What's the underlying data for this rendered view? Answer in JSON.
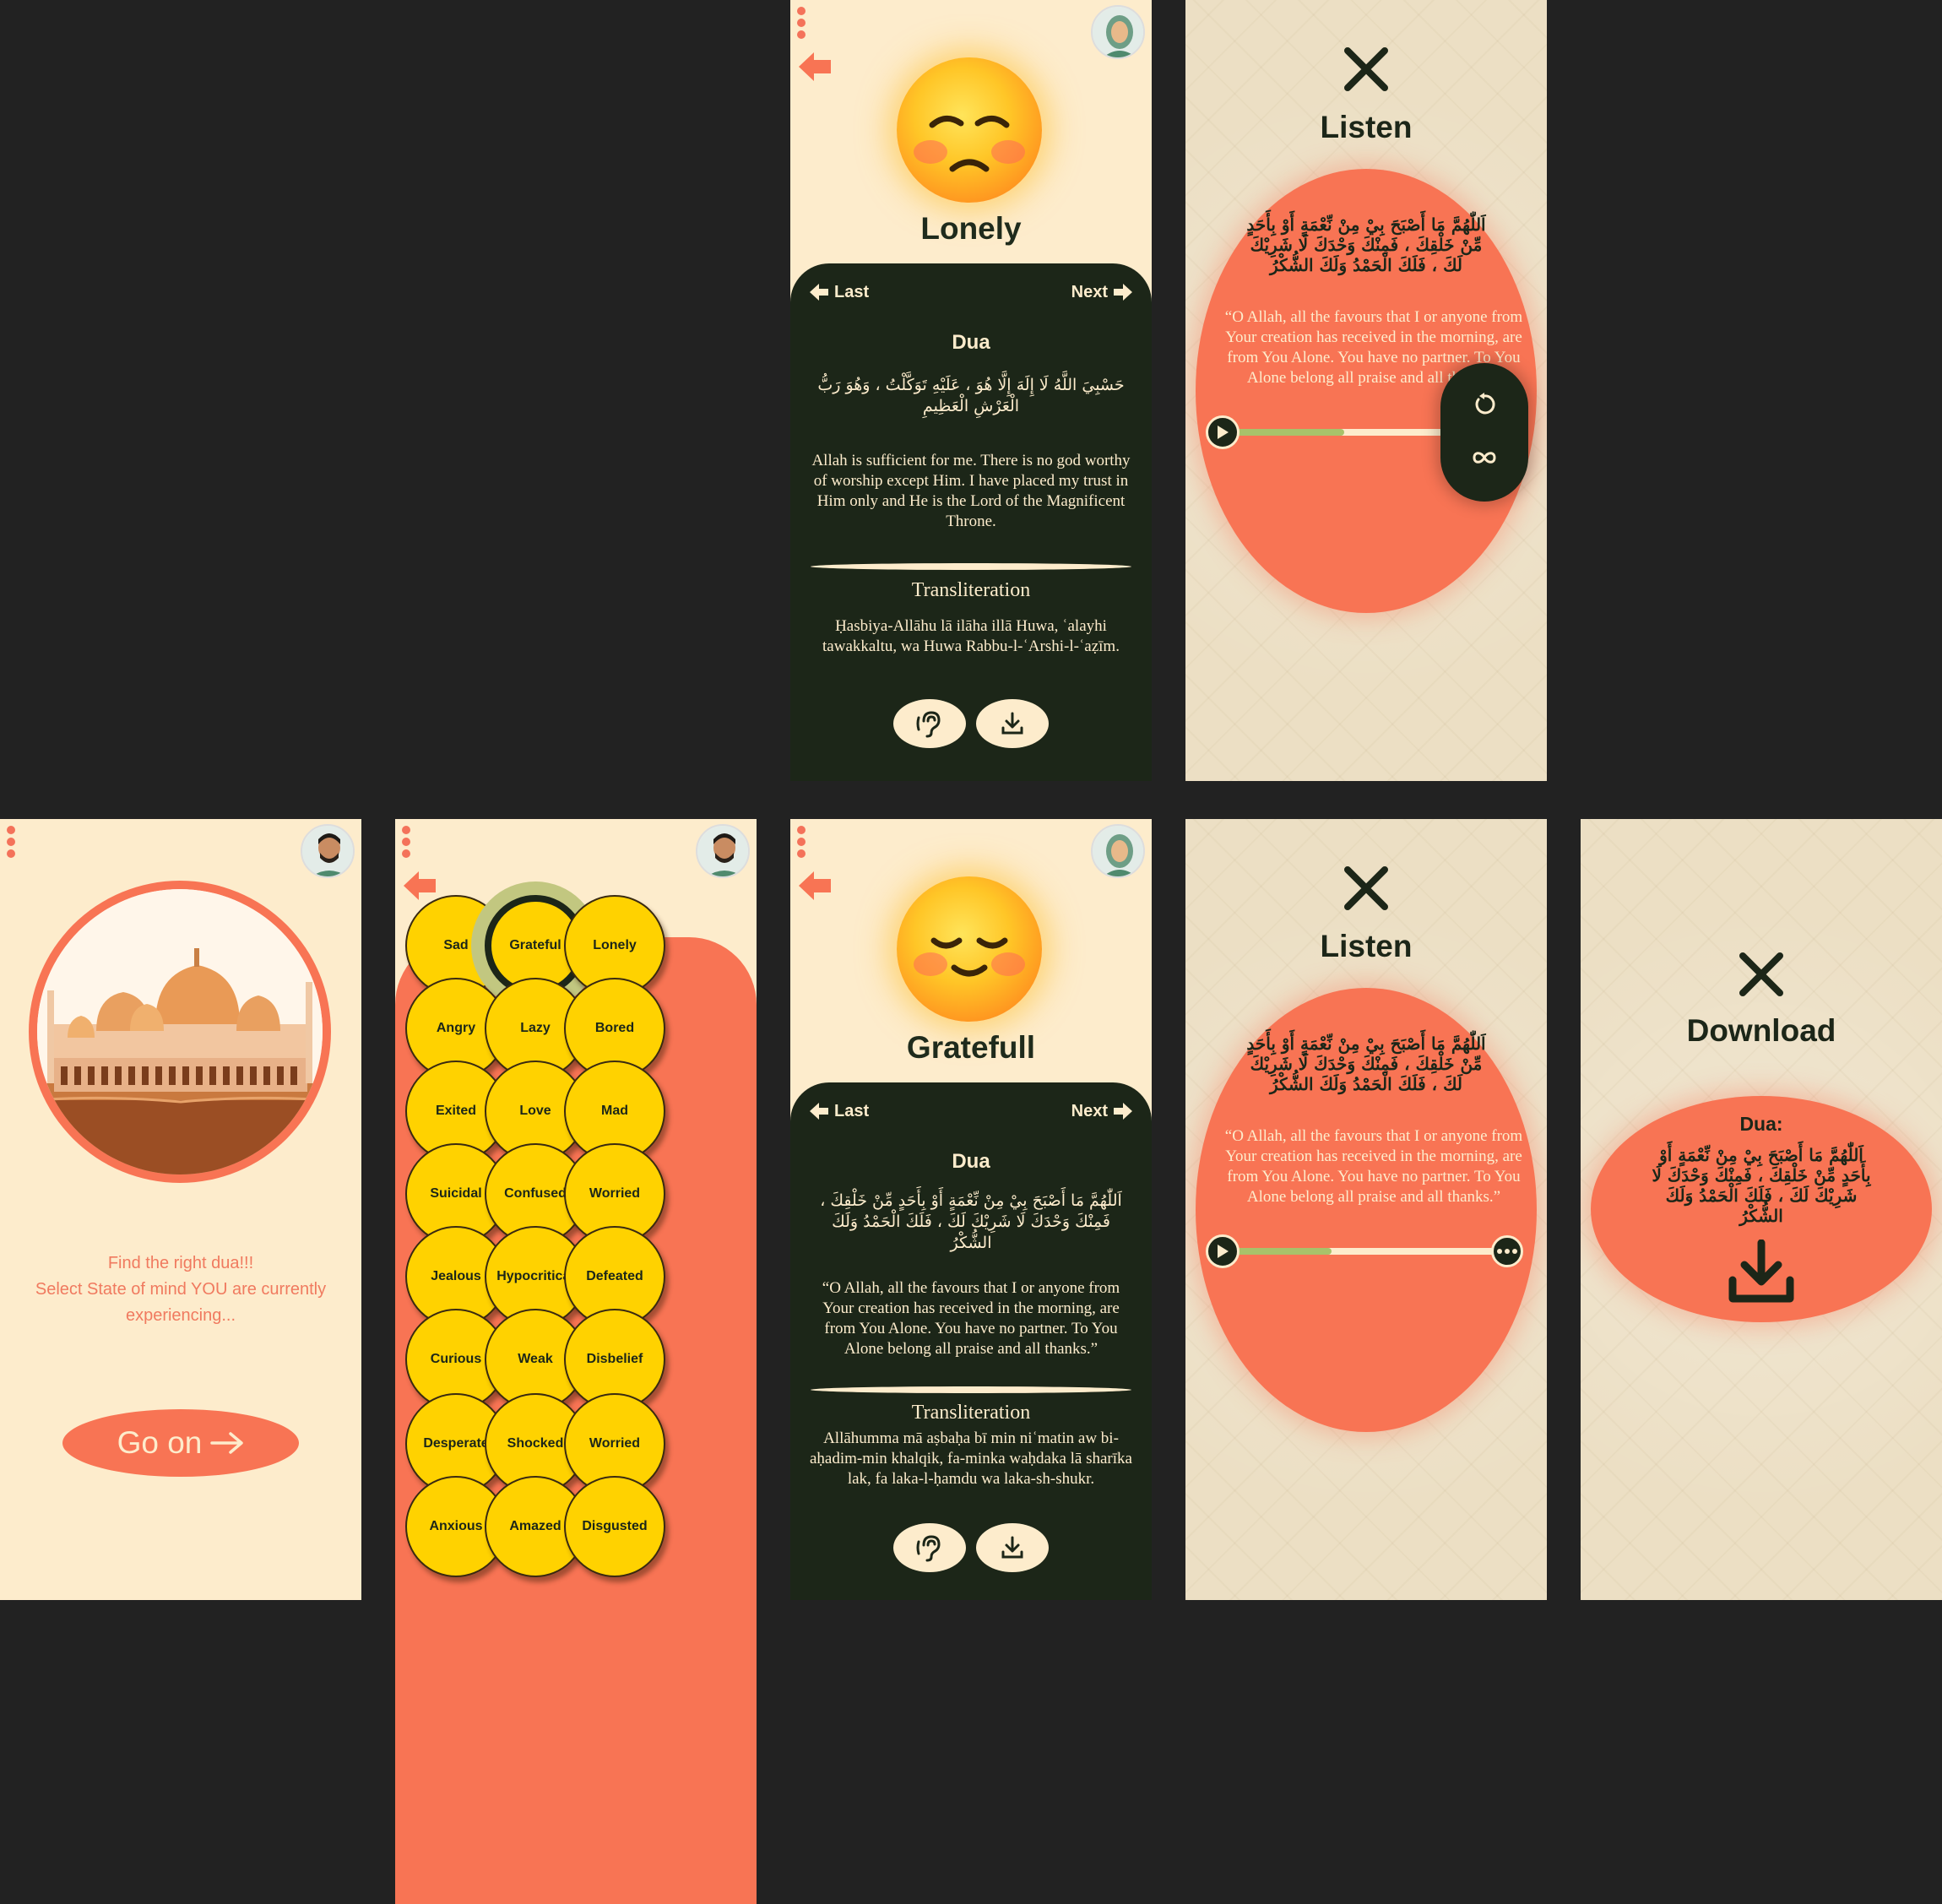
{
  "screens": {
    "lonely": {
      "mood_title": "Lonely",
      "last_label": "Last",
      "next_label": "Next",
      "dua_heading": "Dua",
      "arabic": "حَسْبِيَ اللَّهُ لَا إِلَهَ إِلَّا هُوَ ، عَلَيْهِ تَوَكَّلْتُ ، وَهُوَ رَبُّ الْعَرْشِ الْعَظِيمِ",
      "translation": "Allah is sufficient for me. There is no god worthy of worship except Him. I have placed my trust in Him only and He is the Lord of the Magnificent Throne.",
      "translit_heading": "Transliteration",
      "transliteration": "Ḥasbiya-Allāhu lā ilāha illā Huwa, ʿalayhi tawakkaltu, wa Huwa Rabbu-l-ʿArshi-l-ʿaẓīm."
    },
    "listen_menu": {
      "title": "Listen",
      "arabic": "اَللّٰهُمَّ مَا أَصْبَحَ بِيْ مِنْ نِّعْمَةٍ أَوْ بِأَحَدٍ مِّنْ خَلْقِكَ ، فَمِنْكَ وَحْدَكَ لَا شَرِيْكَ لَكَ ، فَلَكَ الْحَمْدُ وَلَكَ الشُّكْرُ",
      "translation": "“O Allah, all the favours that I or anyone from Your creation has received in the morning, are from You Alone. You have no partner. To You Alone belong all praise and all thanks.”",
      "progress": 0.48
    },
    "welcome": {
      "find_text_1": "Find the right dua!!!",
      "find_text_2": "Select State of mind YOU are currently experiencing...",
      "go_label": "Go on"
    },
    "moods": {
      "items": [
        "Sad",
        "Grateful",
        "Lonely",
        "Angry",
        "Lazy",
        "Bored",
        "Exited",
        "Love",
        "Mad",
        "Suicidal",
        "Confused",
        "Worried",
        "Jealous",
        "Hypocritical",
        "Defeated",
        "Curious",
        "Weak",
        "Disbelief",
        "Desperate",
        "Shocked",
        "Worried",
        "Anxious",
        "Amazed",
        "Disgusted"
      ],
      "selected": "Grateful"
    },
    "grateful": {
      "mood_title": "Gratefull",
      "last_label": "Last",
      "next_label": "Next",
      "dua_heading": "Dua",
      "arabic": "اَللّٰهُمَّ مَا أَصْبَحَ بِيْ مِنْ نِّعْمَةٍ أَوْ بِأَحَدٍ مِّنْ خَلْقِكَ ، فَمِنْكَ وَحْدَكَ لَا شَرِيْكَ لَكَ ، فَلَكَ الْحَمْدُ وَلَكَ الشُّكْرُ",
      "translation": "“O Allah, all the favours that I or anyone from Your creation has received in the morning, are from You Alone. You have no partner. To You Alone belong all praise and all thanks.”",
      "translit_heading": "Transliteration",
      "transliteration": "Allāhumma mā aṣbaḥa bī min niʿmatin aw bi-aḥadim-min khalqik, fa-minka waḥdaka lā sharīka lak, fa laka-l-ḥamdu wa laka-sh-shukr."
    },
    "listen": {
      "title": "Listen",
      "arabic": "اَللّٰهُمَّ مَا أَصْبَحَ بِيْ مِنْ نِّعْمَةٍ أَوْ بِأَحَدٍ مِّنْ خَلْقِكَ ، فَمِنْكَ وَحْدَكَ لَا شَرِيْكَ لَكَ ، فَلَكَ الْحَمْدُ وَلَكَ الشُّكْرُ",
      "translation": "“O Allah, all the favours that I or anyone from Your creation has received in the morning, are from You Alone. You have no partner. To You Alone belong all praise and all thanks.”",
      "progress": 0.48
    },
    "download": {
      "title": "Download",
      "dua_label": "Dua:",
      "arabic": "اَللّٰهُمَّ مَا أَصْبَحَ بِيْ مِنْ نِّعْمَةٍ أَوْ بِأَحَدٍ مِّنْ خَلْقِكَ ، فَمِنْكَ وَحْدَكَ لَا شَرِيْكَ لَكَ ، فَلَكَ الْحَمْدُ وَلَكَ الشُّكْرُ"
    }
  },
  "icons": {
    "menu": "three-dots-icon",
    "back": "back-arrow-icon",
    "listen": "ear-icon",
    "download": "download-icon",
    "close": "close-icon",
    "play": "play-icon",
    "replay": "replay-icon",
    "loop": "infinity-icon",
    "more": "more-icon",
    "arrow": "arrow-right-icon"
  },
  "colors": {
    "background": "#222222",
    "cream": "#fdeccc",
    "coral": "#f87454",
    "dark_green": "#1c2618",
    "yellow": "#ffd200",
    "progress_green": "#a8c26a"
  }
}
